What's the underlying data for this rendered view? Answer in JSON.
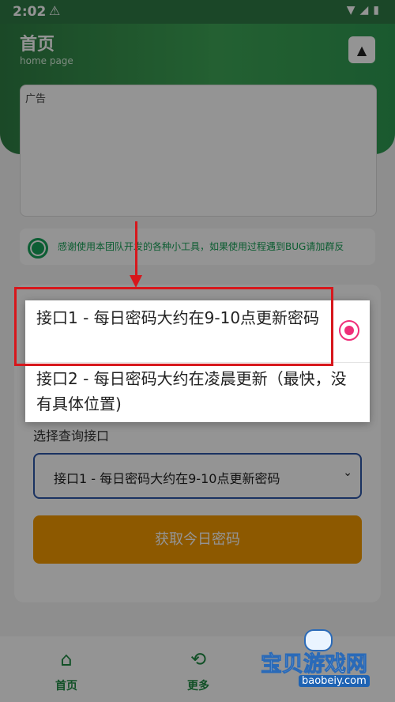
{
  "status_bar": {
    "time": "2:02"
  },
  "header": {
    "title": "首页",
    "subtitle": "home page"
  },
  "ad": {
    "alt_text": "广告"
  },
  "notice": {
    "text": "感谢使用本团队开发的各种小工具，如果使用过程遇到BUG请加群反"
  },
  "form": {
    "select_label": "选择查询接口",
    "select_value": "接口1 - 每日密码大约在9-10点更新密码",
    "button_label": "获取今日密码"
  },
  "popup": {
    "options": [
      {
        "label": "接口1 - 每日密码大约在9-10点更新密码",
        "selected": true
      },
      {
        "label": "接口2 - 每日密码大约在凌晨更新（最快，没有具体位置)",
        "selected": false
      }
    ]
  },
  "bottom_nav": {
    "items": [
      {
        "label": "首页",
        "icon": "home-icon"
      },
      {
        "label": "更多",
        "icon": "more-icon"
      }
    ]
  },
  "watermark": {
    "main": "宝贝游戏网",
    "sub": "baobeiy.com"
  },
  "colors": {
    "brand_green": "#2f7e44",
    "button_orange": "#f39a00",
    "radio_pink": "#ef2e79",
    "annotation_red": "#d7171c"
  }
}
